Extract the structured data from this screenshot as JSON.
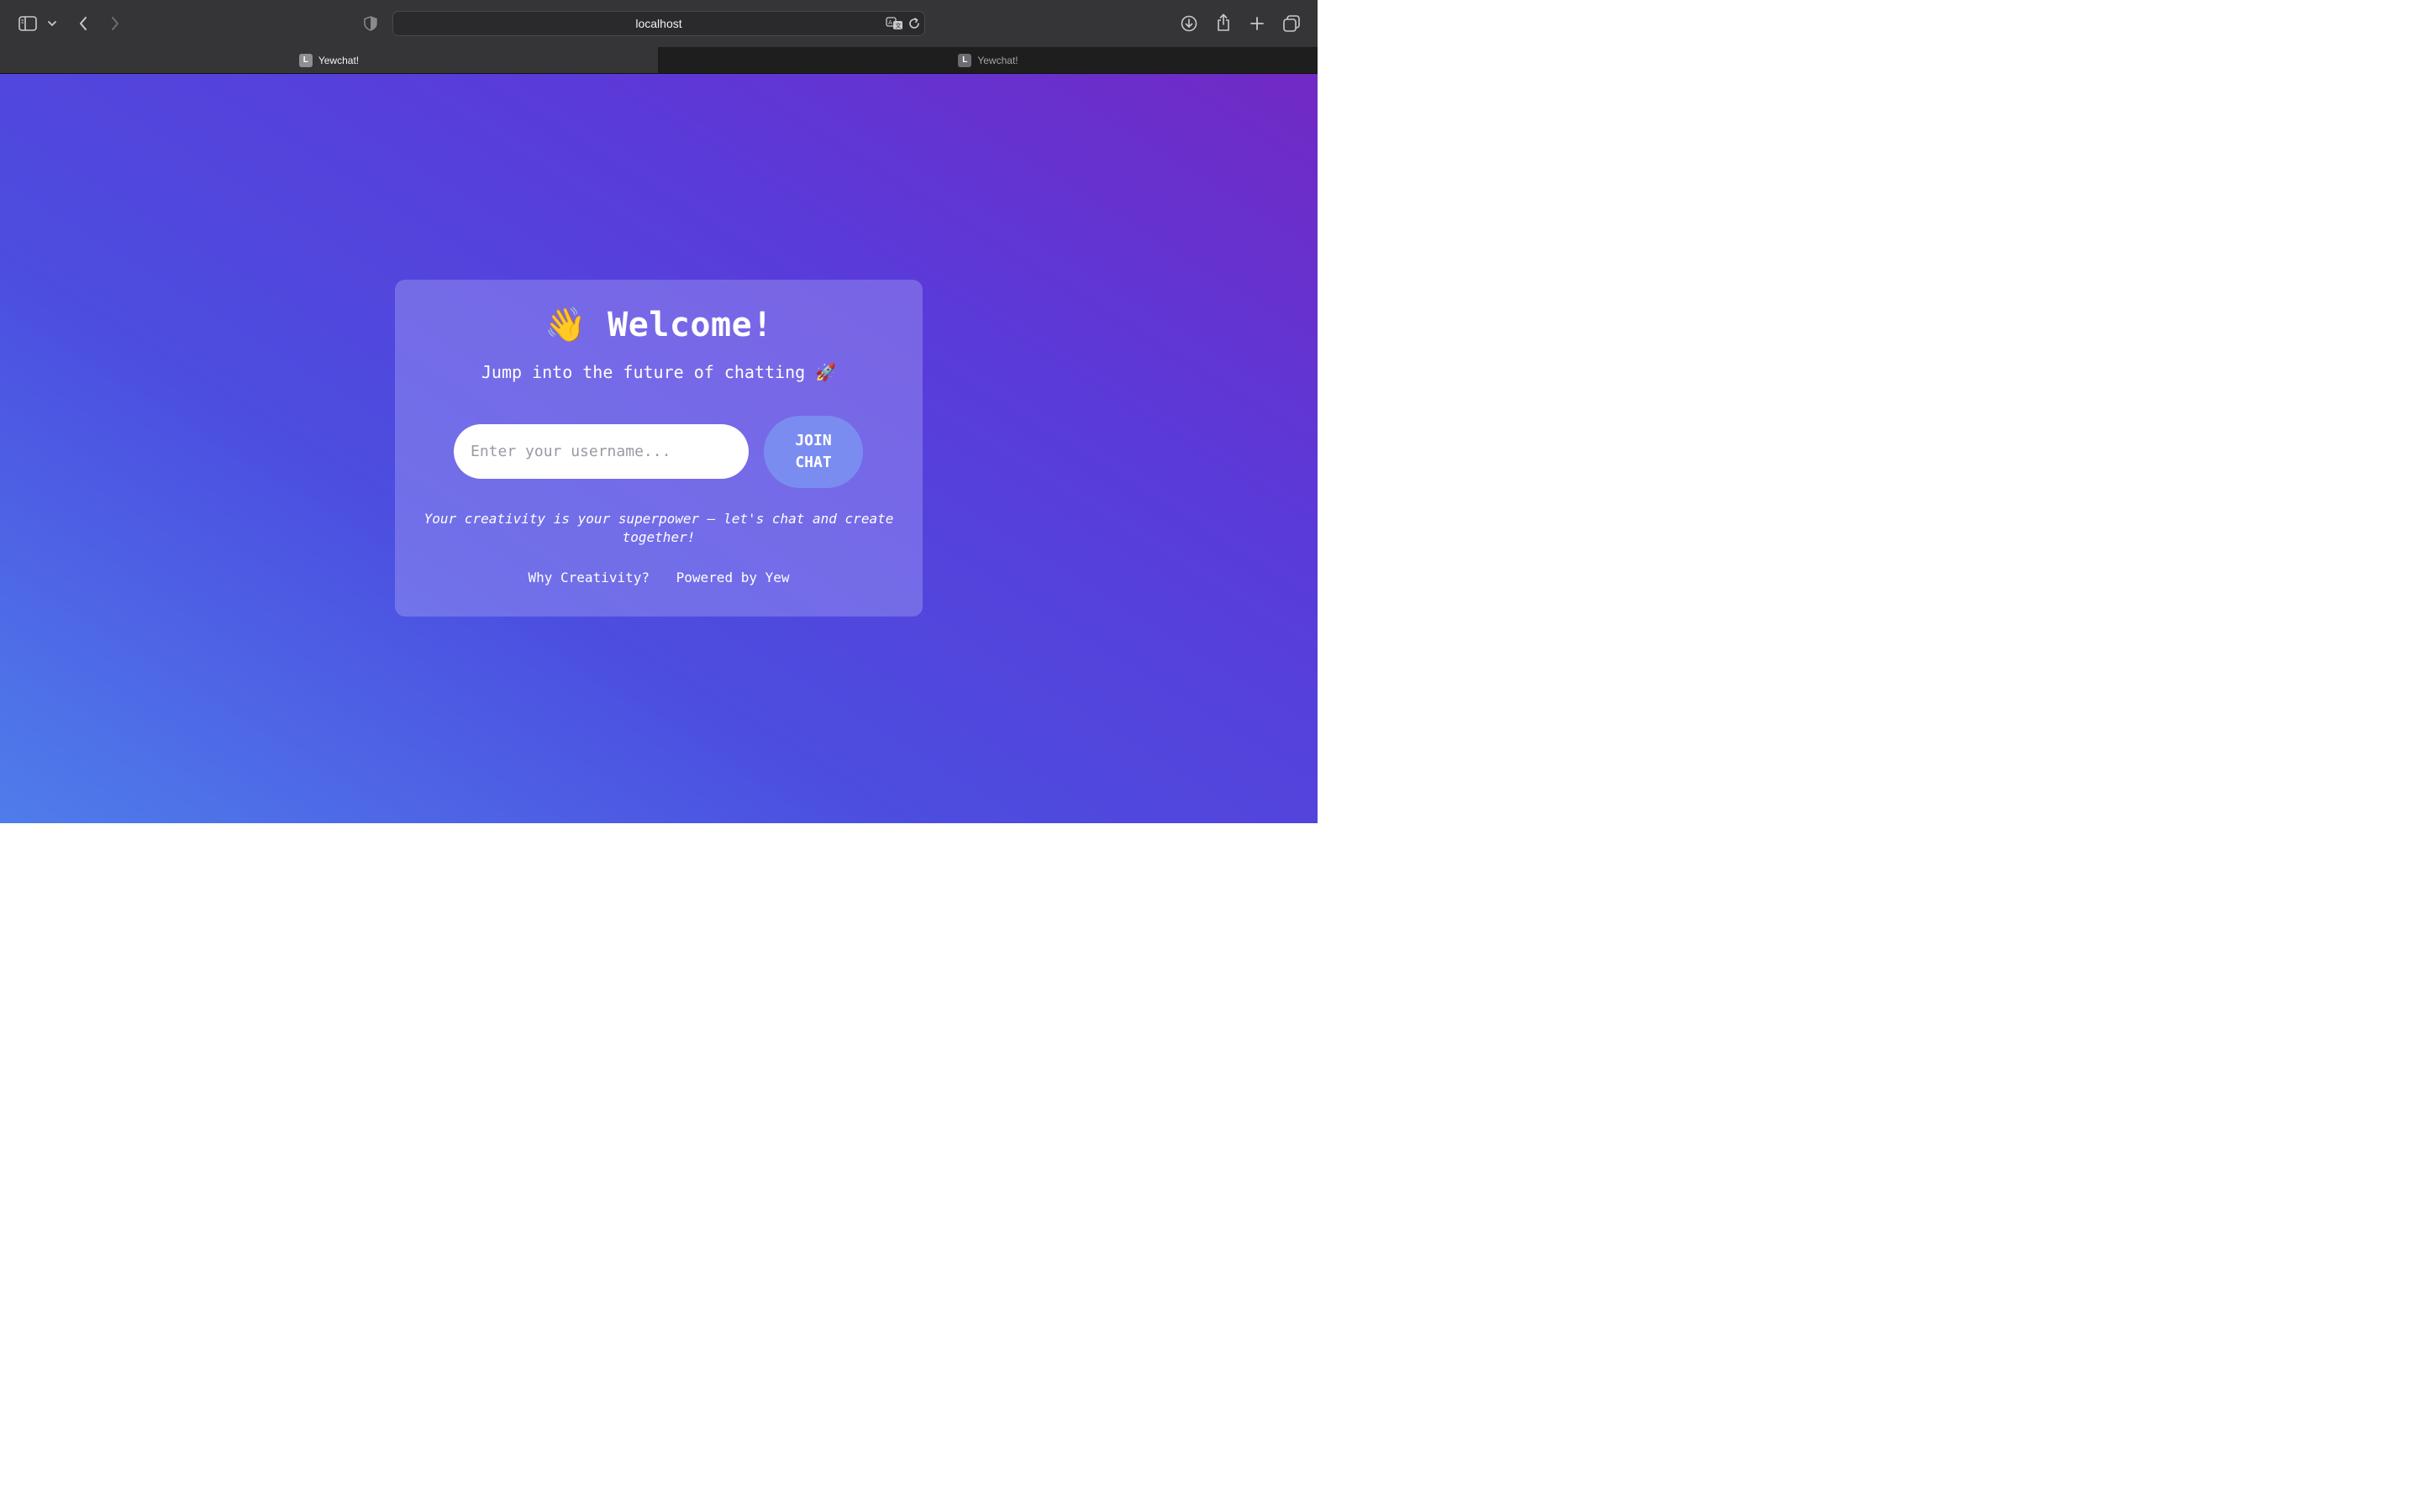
{
  "browser": {
    "address": "localhost",
    "tabs": [
      {
        "favicon": "L",
        "title": "Yewchat!",
        "active": true
      },
      {
        "favicon": "L",
        "title": "Yewchat!",
        "active": false
      }
    ],
    "icons": {
      "sidebar": "sidebar-icon",
      "sidebar_menu": "chevron-down-icon",
      "back": "back-icon",
      "forward": "forward-icon",
      "privacy": "shield-icon",
      "translate": "translate-icon",
      "reload": "reload-icon",
      "downloads": "download-icon",
      "share": "share-icon",
      "new_tab": "plus-icon",
      "tab_overview": "tab-overview-icon"
    }
  },
  "login": {
    "title": "👋 Welcome!",
    "subtitle": "Jump into the future of chatting 🚀",
    "username_placeholder": "Enter your username...",
    "username_value": "",
    "join_label": "JOIN\nCHAT",
    "tagline": "Your creativity is your superpower — let's chat and create together!",
    "links": [
      "Why Creativity?",
      "Powered by Yew"
    ]
  },
  "colors": {
    "gradient_start": "#4f7deb",
    "gradient_mid": "#4c4ee0",
    "gradient_end": "#7229c4",
    "button": "#7b8cf0",
    "card": "rgba(165,160,245,0.42)"
  }
}
